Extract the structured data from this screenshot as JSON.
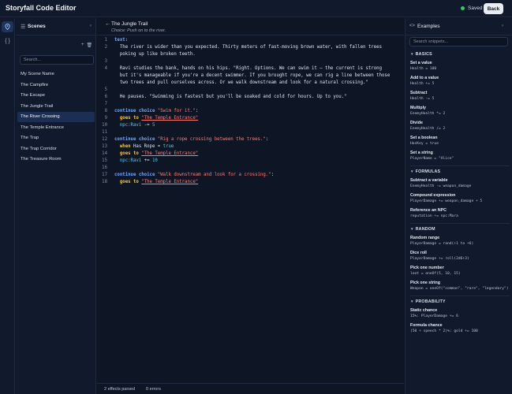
{
  "app": {
    "title": "Storyfall Code Editor",
    "saved_label": "Saved",
    "back_label": "Back"
  },
  "rail": {
    "scenes_icon": "map-pin-icon",
    "code_icon": "braces-icon"
  },
  "scenes": {
    "title": "Scenes",
    "search_placeholder": "Search...",
    "items": [
      {
        "label": "My Scene Name",
        "active": false
      },
      {
        "label": "The Campfire",
        "active": false
      },
      {
        "label": "The Escape",
        "active": false
      },
      {
        "label": "The Jungle Trail",
        "active": false
      },
      {
        "label": "The River Crossing",
        "active": true
      },
      {
        "label": "The Temple Entrance",
        "active": false
      },
      {
        "label": "The Trap",
        "active": false
      },
      {
        "label": "The Trap Corridor",
        "active": false
      },
      {
        "label": "The Treasure Room",
        "active": false
      }
    ]
  },
  "editor": {
    "scene_title": "The Jungle Trail",
    "choice": "Choice: Push on to the river.",
    "lines": [
      {
        "n": "1",
        "segs": [
          {
            "t": "text:",
            "c": "kw-blue"
          }
        ]
      },
      {
        "n": "2",
        "segs": [
          {
            "t": "  The river is wider than you expected. Thirty meters of fast-moving brown water, with fallen trees",
            "c": ""
          }
        ]
      },
      {
        "n": "",
        "segs": [
          {
            "t": "  poking up like broken teeth.",
            "c": ""
          }
        ]
      },
      {
        "n": "3",
        "segs": []
      },
      {
        "n": "4",
        "segs": [
          {
            "t": "  Ravi studies the bank, hands on his hips. \"Right. Options. We can swim it — the current is strong",
            "c": ""
          }
        ]
      },
      {
        "n": "",
        "segs": [
          {
            "t": "  but it's manageable if you're a decent swimmer. If you brought rope, we can rig a line between those",
            "c": ""
          }
        ]
      },
      {
        "n": "",
        "segs": [
          {
            "t": "  two trees and pull ourselves across. Or we walk downstream and look for a natural crossing.\"",
            "c": ""
          }
        ]
      },
      {
        "n": "5",
        "segs": []
      },
      {
        "n": "6",
        "segs": [
          {
            "t": "  He pauses. \"Swimming is fastest but you'll be soaked and cold for hours. Up to you.\"",
            "c": ""
          }
        ]
      },
      {
        "n": "7",
        "segs": []
      },
      {
        "n": "8",
        "segs": [
          {
            "t": "continue choice ",
            "c": "kw-blue"
          },
          {
            "t": "\"Swim for it.\"",
            "c": "str"
          },
          {
            "t": ":",
            "c": ""
          }
        ]
      },
      {
        "n": "9",
        "segs": [
          {
            "t": "  ",
            "c": ""
          },
          {
            "t": "goes to ",
            "c": "kw-yellow"
          },
          {
            "t": "\"The Temple Entrance\"",
            "c": "link"
          }
        ]
      },
      {
        "n": "10",
        "segs": [
          {
            "t": "  ",
            "c": ""
          },
          {
            "t": "npc:Ravi",
            "c": "var"
          },
          {
            "t": " -= ",
            "c": ""
          },
          {
            "t": "5",
            "c": "var"
          }
        ]
      },
      {
        "n": "11",
        "segs": []
      },
      {
        "n": "12",
        "segs": [
          {
            "t": "continue choice ",
            "c": "kw-blue"
          },
          {
            "t": "\"Rig a rope crossing between the trees.\"",
            "c": "str"
          },
          {
            "t": ":",
            "c": ""
          }
        ]
      },
      {
        "n": "13",
        "segs": [
          {
            "t": "  ",
            "c": ""
          },
          {
            "t": "when ",
            "c": "kw-yellow"
          },
          {
            "t": "Has Rope = ",
            "c": ""
          },
          {
            "t": "true",
            "c": "var"
          }
        ]
      },
      {
        "n": "14",
        "segs": [
          {
            "t": "  ",
            "c": ""
          },
          {
            "t": "goes to ",
            "c": "kw-yellow"
          },
          {
            "t": "\"The Temple Entrance\"",
            "c": "link"
          }
        ]
      },
      {
        "n": "15",
        "segs": [
          {
            "t": "  ",
            "c": ""
          },
          {
            "t": "npc:Ravi",
            "c": "var"
          },
          {
            "t": " += ",
            "c": ""
          },
          {
            "t": "10",
            "c": "var"
          }
        ]
      },
      {
        "n": "16",
        "segs": []
      },
      {
        "n": "17",
        "segs": [
          {
            "t": "continue choice ",
            "c": "kw-blue"
          },
          {
            "t": "\"Walk downstream and look for a crossing.\"",
            "c": "str"
          },
          {
            "t": ":",
            "c": ""
          }
        ]
      },
      {
        "n": "18",
        "segs": [
          {
            "t": "  ",
            "c": ""
          },
          {
            "t": "goes to ",
            "c": "kw-yellow"
          },
          {
            "t": "\"The Temple Entrance\"",
            "c": "link"
          }
        ]
      }
    ]
  },
  "status": {
    "effects": "2 effects parsed",
    "errors": "0 errors"
  },
  "examples": {
    "title": "Examples",
    "search_placeholder": "Search snippets...",
    "sections": [
      {
        "title": "BASICS",
        "items": [
          {
            "label": "Set a value",
            "code": "Health = 100"
          },
          {
            "label": "Add to a value",
            "code": "Health += 5"
          },
          {
            "label": "Subtract",
            "code": "Health -= 5"
          },
          {
            "label": "Multiply",
            "code": "EnemyHealth *= 2"
          },
          {
            "label": "Divide",
            "code": "EnemyHealth /= 2"
          },
          {
            "label": "Set a boolean",
            "code": "HasKey = true"
          },
          {
            "label": "Set a string",
            "code": "PlayerName = \"Alice\""
          }
        ]
      },
      {
        "title": "FORMULAS",
        "items": [
          {
            "label": "Subtract a variable",
            "code": "EnemyHealth -= weapon_damage"
          },
          {
            "label": "Compound expression",
            "code": "PlayerDamage += weapon_damage + 5"
          },
          {
            "label": "Reference an NPC",
            "code": "reputation += npc:Mara"
          }
        ]
      },
      {
        "title": "RANDOM",
        "items": [
          {
            "label": "Random range",
            "code": "PlayerDamage = rand(+1 to +6)"
          },
          {
            "label": "Dice roll",
            "code": "PlayerDamage += roll(2d6+3)"
          },
          {
            "label": "Pick one number",
            "code": "loot = oneOf(5, 10, 15)"
          },
          {
            "label": "Pick one string",
            "code": "Weapon = oneOf(\"common\", \"rare\", \"legendary\")"
          }
        ]
      },
      {
        "title": "PROBABILITY",
        "items": [
          {
            "label": "Static chance",
            "code": "15%: PlayerDamage += 6"
          },
          {
            "label": "Formula chance",
            "code": "(50 + speech * 2)%: gold += 100"
          }
        ]
      }
    ]
  }
}
